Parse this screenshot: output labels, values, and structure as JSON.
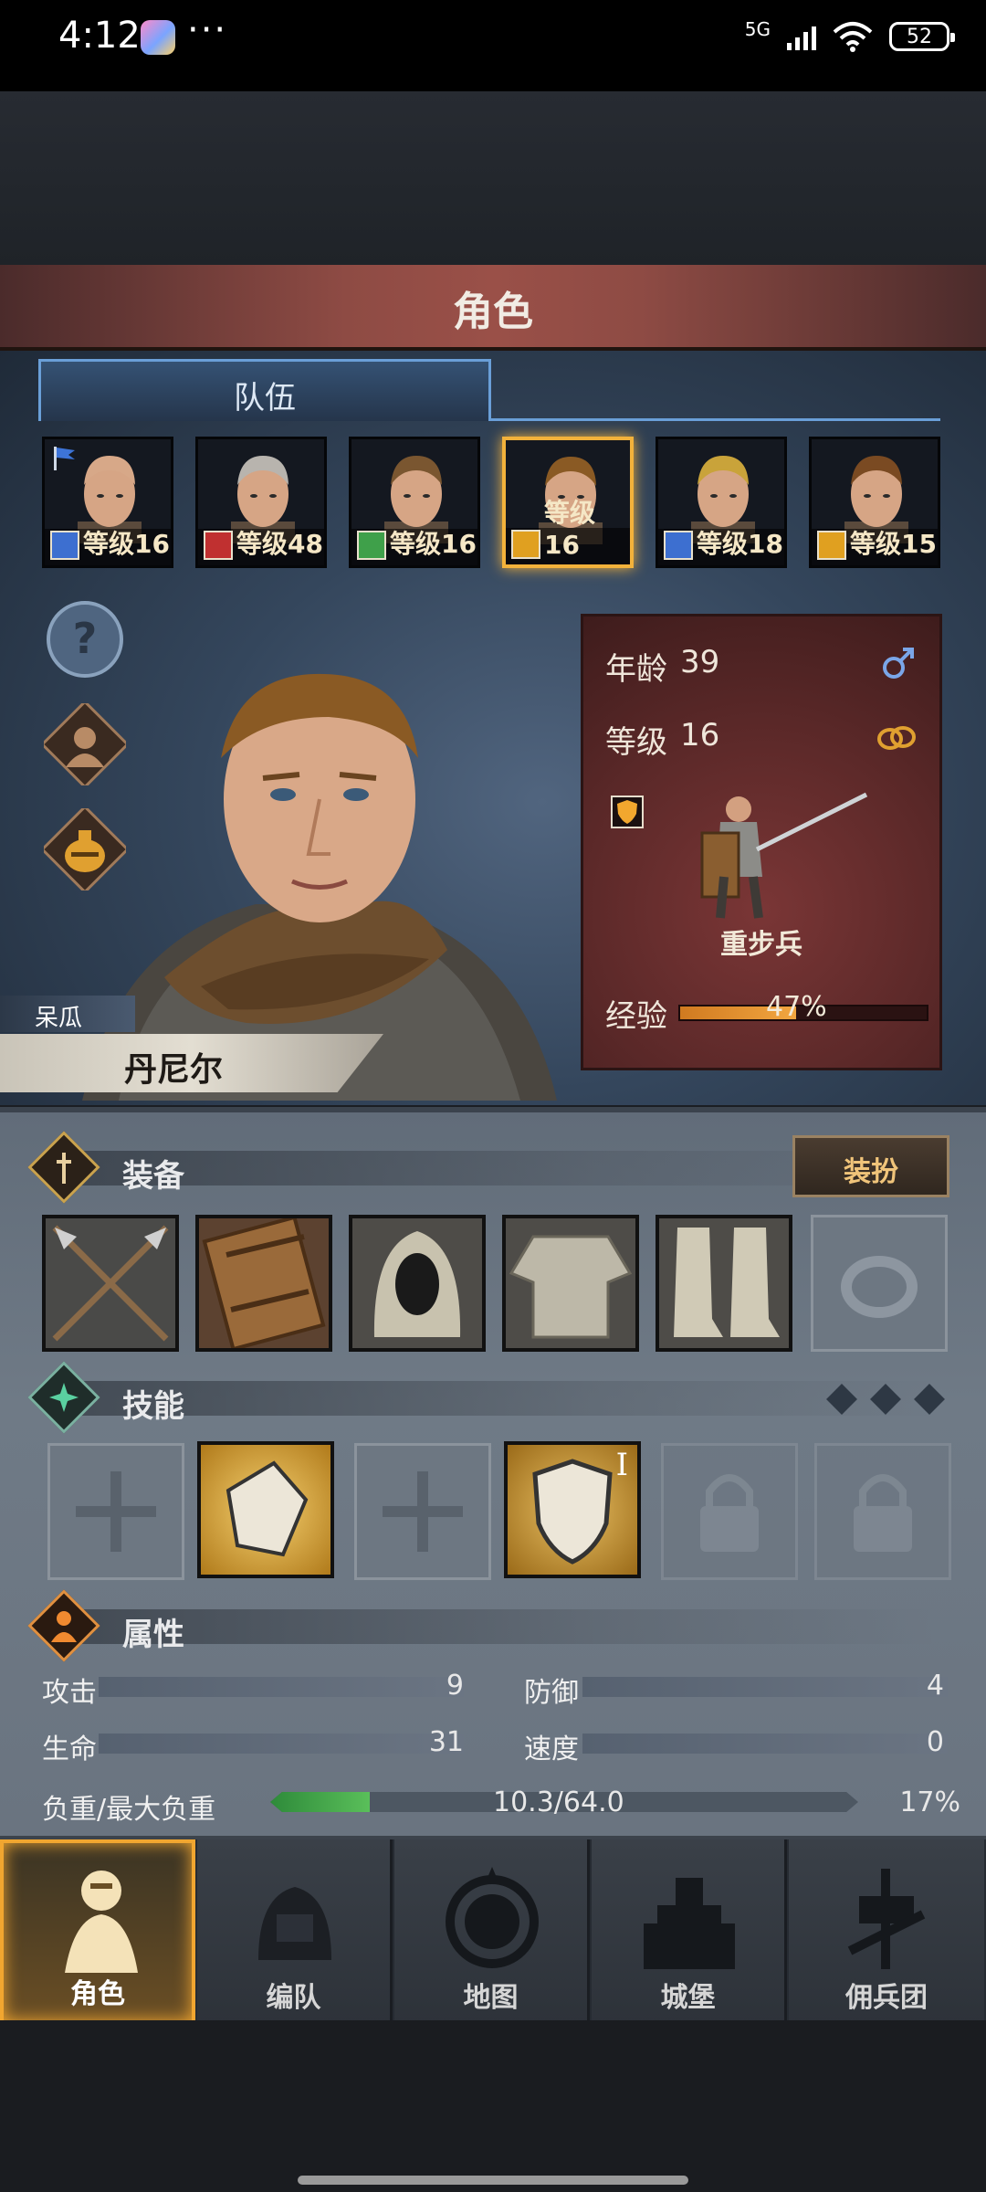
{
  "status_bar": {
    "time": "4:12",
    "network": "5G",
    "battery": "52"
  },
  "header": {
    "title": "角色",
    "tab": "队伍"
  },
  "roster": [
    {
      "level_text": "等级16",
      "class_color": "#3d6fd0",
      "active": false
    },
    {
      "level_text": "等级48",
      "class_color": "#c03030",
      "active": false
    },
    {
      "level_text": "等级16",
      "class_color": "#3fa04a",
      "active": false
    },
    {
      "level_text": "等级16",
      "class_color": "#e0a020",
      "active": true
    },
    {
      "level_text": "等级18",
      "class_color": "#3d6fd0",
      "active": false
    },
    {
      "level_text": "等级15",
      "class_color": "#e0a020",
      "active": false
    }
  ],
  "side_icons": [
    "help-icon",
    "character-bust-icon",
    "potion-bag-icon"
  ],
  "character": {
    "nickname": "呆瓜",
    "name": "丹尼尔",
    "age_label": "年龄",
    "age": "39",
    "level_label": "等级",
    "level": "16",
    "class_name": "重步兵",
    "xp_label": "经验",
    "xp_text": "47%",
    "xp_fraction": 0.47
  },
  "equipment": {
    "title": "装备",
    "outfit_button": "装扮",
    "slots": [
      "crossed-spears",
      "wooden-shield",
      "cloth-hood",
      "chainmail-shirt",
      "cloth-boots",
      "empty-ring"
    ]
  },
  "skills": {
    "title": "技能",
    "slots": [
      "empty-cross",
      "gauntlet-skill",
      "empty-cross",
      "shield-skill",
      "locked",
      "locked"
    ],
    "skill_rank": "I"
  },
  "attributes": {
    "title": "属性",
    "attack_label": "攻击",
    "attack": "9",
    "defense_label": "防御",
    "defense": "4",
    "hp_label": "生命",
    "hp": "31",
    "speed_label": "速度",
    "speed": "0",
    "weight_label": "负重/最大负重",
    "weight_text": "10.3/64.0",
    "weight_percent": "17%",
    "weight_fraction": 0.17
  },
  "nav": [
    {
      "label": "角色",
      "active": true
    },
    {
      "label": "编队",
      "active": false
    },
    {
      "label": "地图",
      "active": false
    },
    {
      "label": "城堡",
      "active": false
    },
    {
      "label": "佣兵团",
      "active": false
    }
  ],
  "colors": {
    "accent": "#f3b23b",
    "xp_fill": "#e08a2a",
    "weight_fill": "#4aa04a"
  }
}
